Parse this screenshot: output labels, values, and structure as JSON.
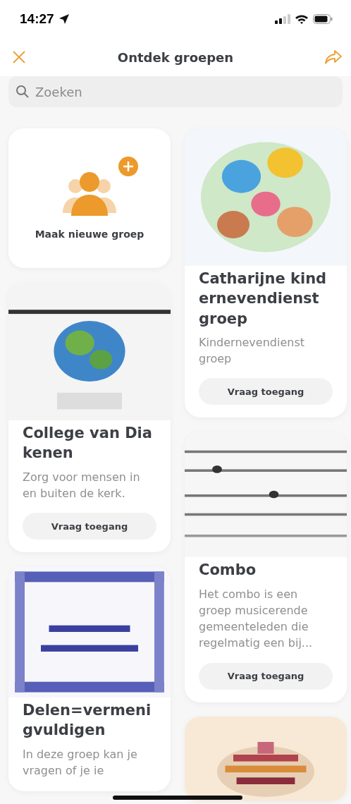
{
  "status_bar": {
    "time": "14:27"
  },
  "header": {
    "title": "Ontdek groepen"
  },
  "search": {
    "placeholder": "Zoeken"
  },
  "columns": [
    {
      "cards": [
        {
          "kind": "create",
          "label": "Maak nieuwe groep"
        },
        {
          "kind": "group",
          "title": "College van Diakenen",
          "description": "Zorg voor mensen in en buiten de kerk.",
          "button": "Vraag toegang"
        },
        {
          "kind": "group",
          "title": "Delen=vermenigvuldigen",
          "description": "In deze groep kan je vragen of je ie"
        }
      ]
    },
    {
      "cards": [
        {
          "kind": "group",
          "title": "Catharijne kindernevendienst groep",
          "description": "Kindernevendienst groep",
          "button": "Vraag toegang"
        },
        {
          "kind": "group",
          "title": "Combo",
          "description": "Het combo is een groep musicerende gemeenteleden die regelmatig een bij...",
          "button": "Vraag toegang"
        },
        {
          "kind": "group"
        }
      ]
    }
  ]
}
